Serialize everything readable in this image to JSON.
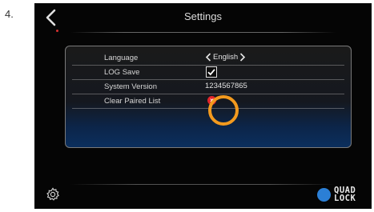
{
  "step_number": "4.",
  "header": {
    "title": "Settings"
  },
  "settings": {
    "language": {
      "label": "Language",
      "value": "English"
    },
    "log_save": {
      "label": "LOG Save",
      "checked": true
    },
    "system_version": {
      "label": "System Version",
      "value": "1234567865"
    },
    "clear_paired_list": {
      "label": "Clear Paired List",
      "button_glyph": "×"
    }
  },
  "footer": {
    "logo_line1": "QUAD",
    "logo_line2": "LOCK"
  },
  "colors": {
    "highlight": "#f39a1e",
    "clear_button": "#e2252b",
    "logo_circle": "#2b7fd6",
    "panel_gradient_end": "#0b2f5e"
  },
  "icons": {
    "back": "chevron-left-icon",
    "settings": "gear-icon",
    "lang_prev": "chevron-left-icon",
    "lang_next": "chevron-right-icon"
  }
}
